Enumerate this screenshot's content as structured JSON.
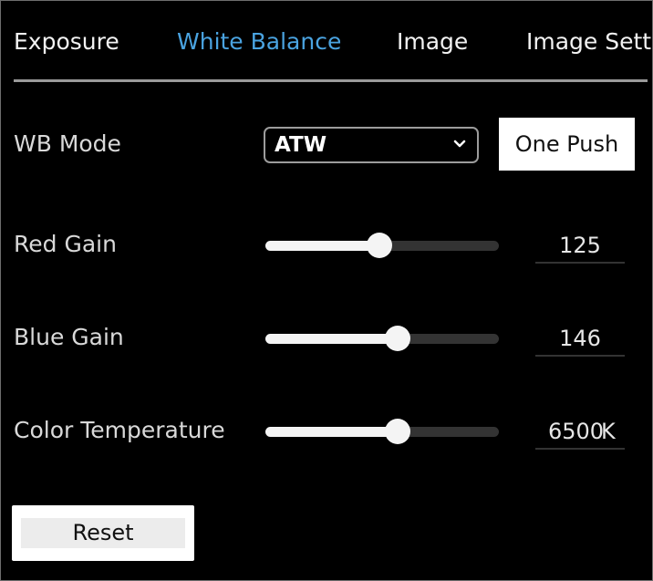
{
  "tabs": [
    {
      "label": "Exposure",
      "active": false
    },
    {
      "label": "White Balance",
      "active": true
    },
    {
      "label": "Image",
      "active": false
    },
    {
      "label": "Image Sett",
      "active": false
    }
  ],
  "wb_mode": {
    "label": "WB Mode",
    "selected": "ATW",
    "one_push_label": "One Push"
  },
  "red_gain": {
    "label": "Red Gain",
    "value": "125",
    "slider_fraction": 0.49
  },
  "blue_gain": {
    "label": "Blue Gain",
    "value": "146",
    "slider_fraction": 0.565
  },
  "color_temperature": {
    "label": "Color Temperature",
    "value": "6500",
    "unit": "K",
    "slider_fraction": 0.565
  },
  "reset_label": "Reset",
  "colors": {
    "accent": "#4aa3e0",
    "background": "#000000",
    "slider_fill": "#f4f4f4",
    "slider_track": "#333333"
  },
  "icons": {
    "select_chevron": "chevron-down-icon"
  }
}
